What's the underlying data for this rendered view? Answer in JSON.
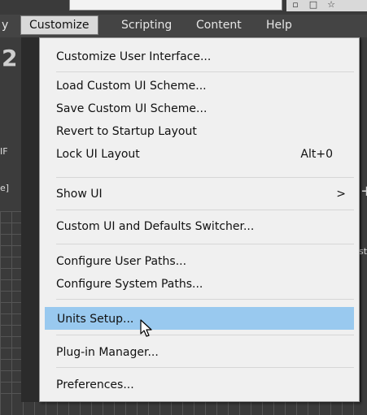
{
  "menubar": {
    "items": [
      {
        "label": "y"
      },
      {
        "label": "Customize"
      },
      {
        "label": "Scripting"
      },
      {
        "label": "Content"
      },
      {
        "label": "Help"
      }
    ]
  },
  "background": {
    "left_number": "2",
    "left_labels": [
      "IF",
      "e]"
    ],
    "right_label": "st"
  },
  "menu": {
    "customize_ui": "Customize User Interface...",
    "load_scheme": "Load Custom UI Scheme...",
    "save_scheme": "Save Custom UI Scheme...",
    "revert": "Revert to Startup Layout",
    "lock_layout": "Lock UI Layout",
    "lock_shortcut": "Alt+0",
    "show_ui": "Show UI",
    "show_ui_arrow": ">",
    "switcher": "Custom UI and Defaults Switcher...",
    "user_paths": "Configure User Paths...",
    "system_paths": "Configure System Paths...",
    "units_setup": "Units Setup...",
    "plugin_manager": "Plug-in Manager...",
    "preferences": "Preferences..."
  },
  "colors": {
    "highlight": "#99c9ef",
    "menu_bg": "#f0f0f0",
    "menubar_bg": "#444444"
  }
}
